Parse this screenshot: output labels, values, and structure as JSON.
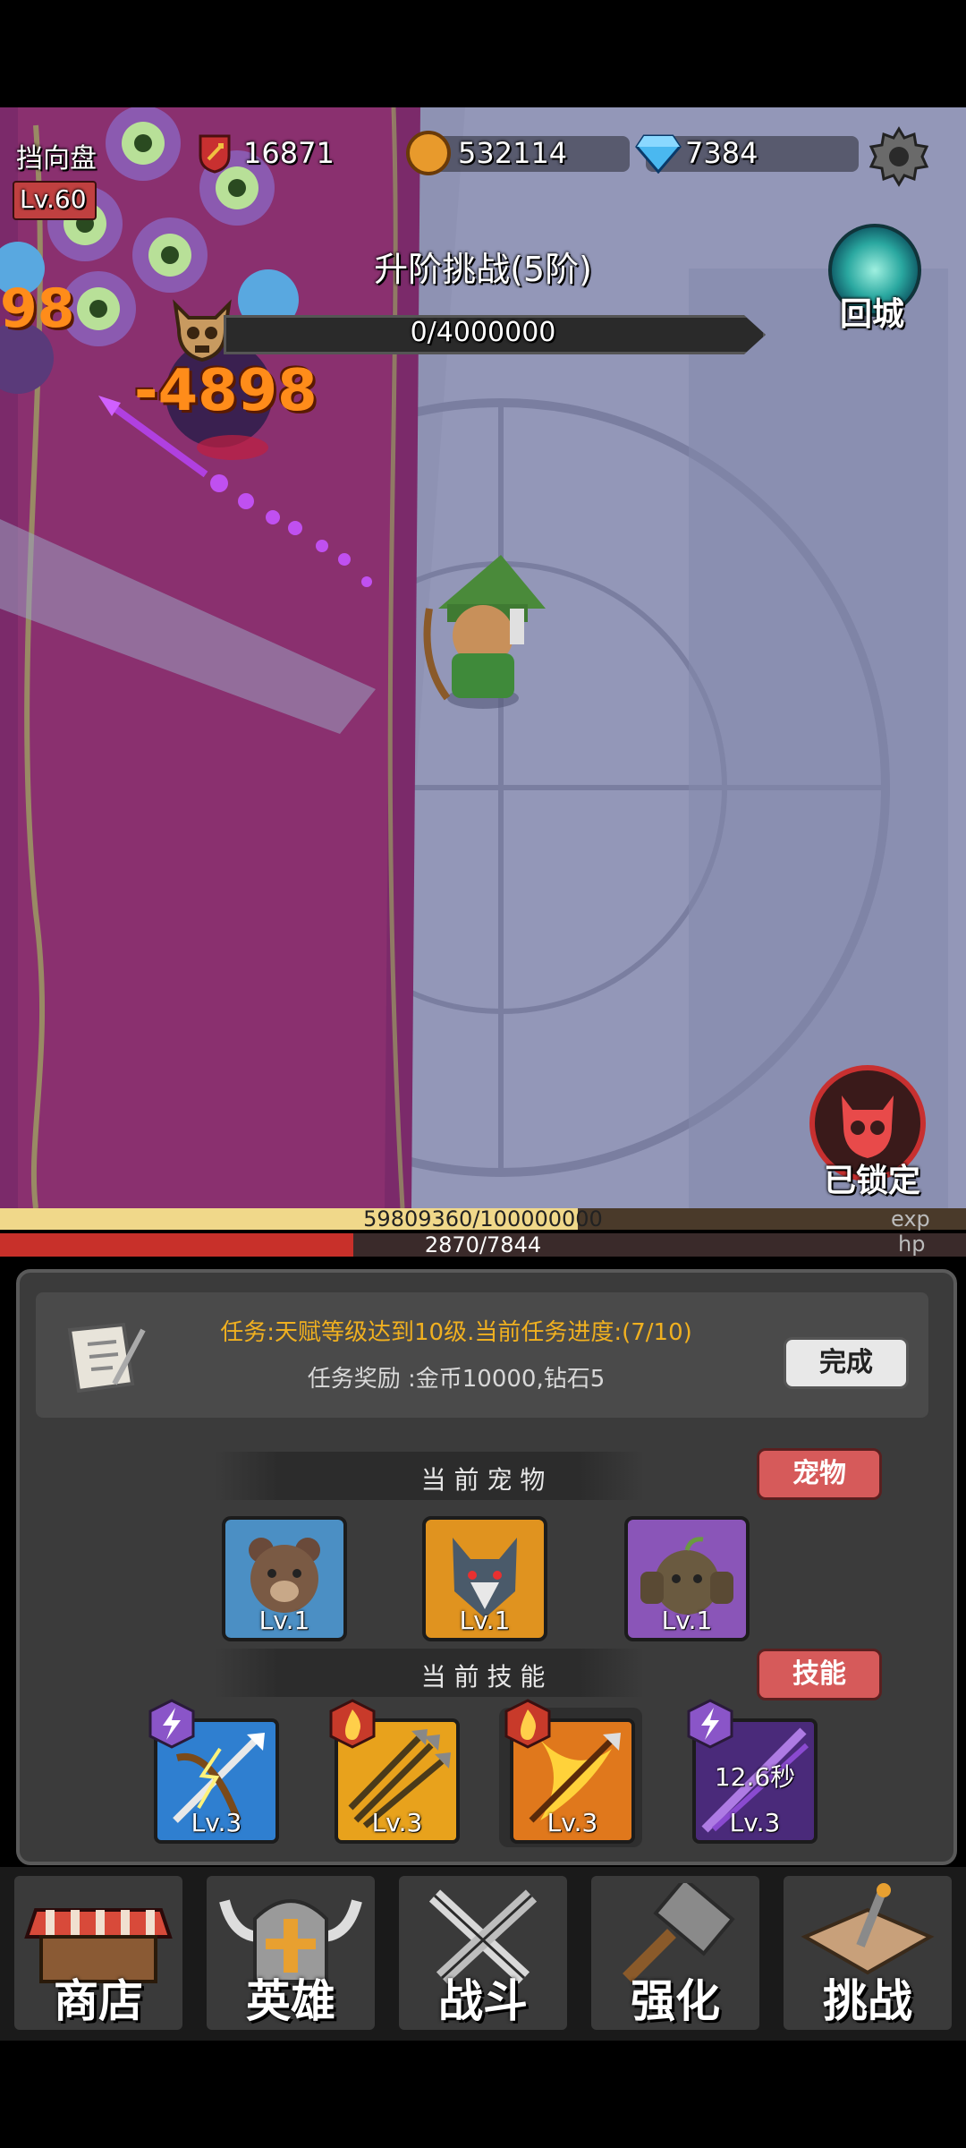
{
  "hud": {
    "wheel_label": "挡向盘",
    "level": "Lv.60",
    "power": "16871",
    "gold": "532114",
    "diamonds": "7384"
  },
  "boss": {
    "challenge_title": "升阶挑战(5阶)",
    "progress_text": "0/4000000",
    "progress": 0
  },
  "buttons": {
    "return_city": "回城",
    "locked": "已锁定"
  },
  "combat": {
    "damage_text": "-4898",
    "damage_side": "98"
  },
  "bars": {
    "exp_text": "59809360/100000000",
    "exp_label": "exp",
    "exp_fraction": 0.598,
    "hp_text": "2870/7844",
    "hp_label": "hp",
    "hp_fraction": 0.366
  },
  "task": {
    "title": "任务:天赋等级达到10级.当前任务进度:(7/10)",
    "reward": "任务奖励 :金币10000,钻石5",
    "complete_button": "完成"
  },
  "pets": {
    "header": "当 前 宠 物",
    "button": "宠物",
    "items": [
      {
        "level": "Lv.1",
        "icon": "bear-pet",
        "bg": "#4b8fc4"
      },
      {
        "level": "Lv.1",
        "icon": "wolf-pet",
        "bg": "#e0931f"
      },
      {
        "level": "Lv.1",
        "icon": "golem-pet",
        "bg": "#8a55b8"
      }
    ]
  },
  "skills": {
    "header": "当 前 技 能",
    "button": "技能",
    "items": [
      {
        "level": "Lv.3",
        "icon": "lightning-arrow",
        "badge": "lightning-badge",
        "bg": "#2f7fd0",
        "cooldown": ""
      },
      {
        "level": "Lv.3",
        "icon": "multi-arrow",
        "badge": "fire-badge",
        "bg": "#e8a21c",
        "cooldown": ""
      },
      {
        "level": "Lv.3",
        "icon": "fire-arrow",
        "badge": "fire-badge",
        "bg": "#e0781c",
        "cooldown": ""
      },
      {
        "level": "Lv.3",
        "icon": "dark-arrow",
        "badge": "lightning-badge",
        "bg": "#4a2a7a",
        "cooldown": "12.6秒"
      }
    ]
  },
  "nav": [
    {
      "label": "商店",
      "icon": "shop-icon"
    },
    {
      "label": "英雄",
      "icon": "helmet-icon"
    },
    {
      "label": "战斗",
      "icon": "swords-icon"
    },
    {
      "label": "强化",
      "icon": "hammer-icon"
    },
    {
      "label": "挑战",
      "icon": "map-icon"
    }
  ],
  "colors": {
    "exp": "#f0d88a",
    "hp": "#c8302a",
    "gold": "#e89a2c",
    "diamond": "#4ab8f0",
    "damage": "#ff8c1a"
  }
}
